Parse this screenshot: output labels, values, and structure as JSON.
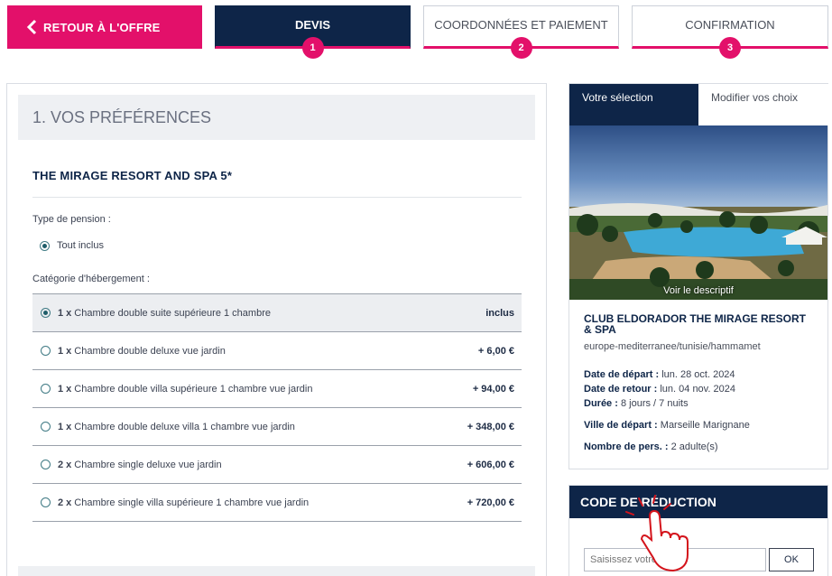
{
  "steps": {
    "back_label": "RETOUR À L'OFFRE",
    "items": [
      {
        "label": "DEVIS",
        "number": "1"
      },
      {
        "label": "COORDONNÉES ET PAIEMENT",
        "number": "2"
      },
      {
        "label": "CONFIRMATION",
        "number": "3"
      }
    ]
  },
  "preferences": {
    "section_title": "1. VOS PRÉFÉRENCES",
    "hotel_name": "THE MIRAGE RESORT AND SPA 5*",
    "pension_label": "Type de pension :",
    "pension_option": "Tout inclus",
    "category_label": "Catégorie d'hébergement :",
    "rooms": [
      {
        "qty": "1 x",
        "name": "Chambre double suite supérieure 1 chambre",
        "price": "inclus"
      },
      {
        "qty": "1 x",
        "name": "Chambre double deluxe vue jardin",
        "price": "+ 6,00 €"
      },
      {
        "qty": "1 x",
        "name": "Chambre double villa supérieure 1 chambre vue jardin",
        "price": "+ 94,00 €"
      },
      {
        "qty": "1 x",
        "name": "Chambre double deluxe villa 1 chambre vue jardin",
        "price": "+ 348,00 €"
      },
      {
        "qty": "2 x",
        "name": "Chambre single deluxe vue jardin",
        "price": "+ 606,00 €"
      },
      {
        "qty": "2 x",
        "name": "Chambre single villa supérieure 1 chambre vue jardin",
        "price": "+ 720,00 €"
      }
    ]
  },
  "selection": {
    "tab_active": "Votre sélection",
    "tab_inactive": "Modifier vos choix",
    "photo_caption": "Voir le descriptif",
    "club_name": "CLUB ELDORADOR THE MIRAGE RESORT & SPA",
    "path": "europe-mediterranee/tunisie/hammamet",
    "depart_label": "Date de départ :",
    "depart_value": "lun. 28 oct. 2024",
    "retour_label": "Date de retour :",
    "retour_value": "lun. 04 nov. 2024",
    "duree_label": "Durée :",
    "duree_value": "8 jours / 7 nuits",
    "ville_label": "Ville de départ :",
    "ville_value": "Marseille Marignane",
    "pers_label": "Nombre de pers. :",
    "pers_value": "2 adulte(s)"
  },
  "promo": {
    "title": "CODE DE RÉDUCTION",
    "placeholder": "Saisissez votre code",
    "ok_label": "OK"
  },
  "colors": {
    "accent": "#e3106a",
    "navy": "#0e2548"
  }
}
